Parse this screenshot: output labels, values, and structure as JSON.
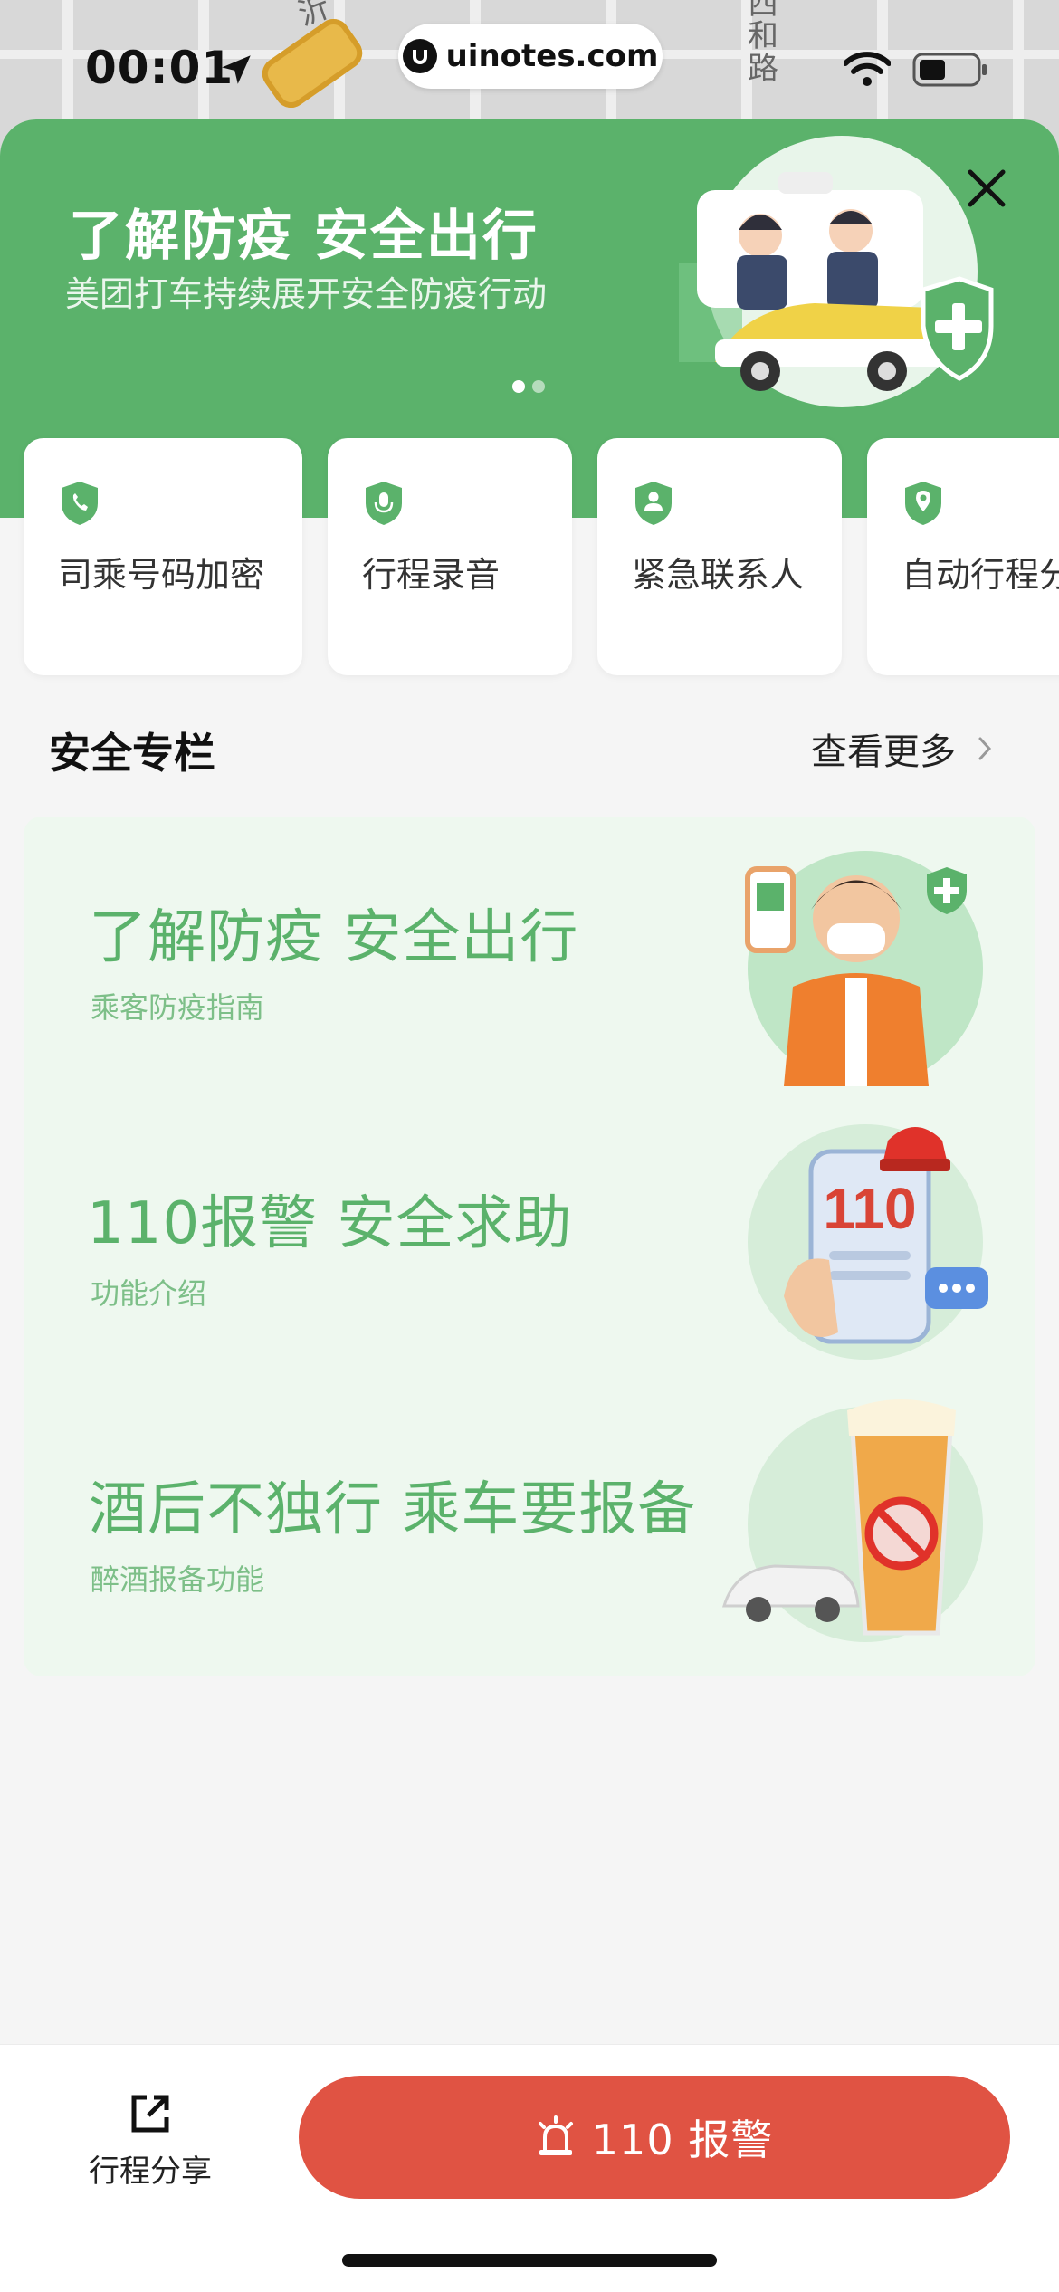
{
  "status_bar": {
    "time": "00:01",
    "url": "uinotes.com",
    "map_labels": [
      "沂",
      "西和路"
    ]
  },
  "hero": {
    "title": "了解防疫 安全出行",
    "subtitle": "美团打车持续展开安全防疫行动",
    "page_count": 2,
    "active_page": 1
  },
  "features": [
    {
      "label": "司乘号码加密",
      "icon": "phone-shield-icon"
    },
    {
      "label": "行程录音",
      "icon": "mic-shield-icon"
    },
    {
      "label": "紧急联系人",
      "icon": "person-shield-icon"
    },
    {
      "label": "自动行程分",
      "icon": "location-shield-icon"
    }
  ],
  "section": {
    "title": "安全专栏",
    "more_label": "查看更多"
  },
  "articles": [
    {
      "title": "了解防疫 安全出行",
      "subtitle": "乘客防疫指南"
    },
    {
      "title": "110报警 安全求助",
      "subtitle": "功能介绍"
    },
    {
      "title": "酒后不独行 乘车要报备",
      "subtitle": "醉酒报备功能"
    }
  ],
  "bottom_bar": {
    "share_label": "行程分享",
    "sos_label": "110 报警"
  },
  "colors": {
    "brand_green": "#5bb26b",
    "alert_red": "#e05343",
    "light_green_bg": "#eef8ef"
  }
}
